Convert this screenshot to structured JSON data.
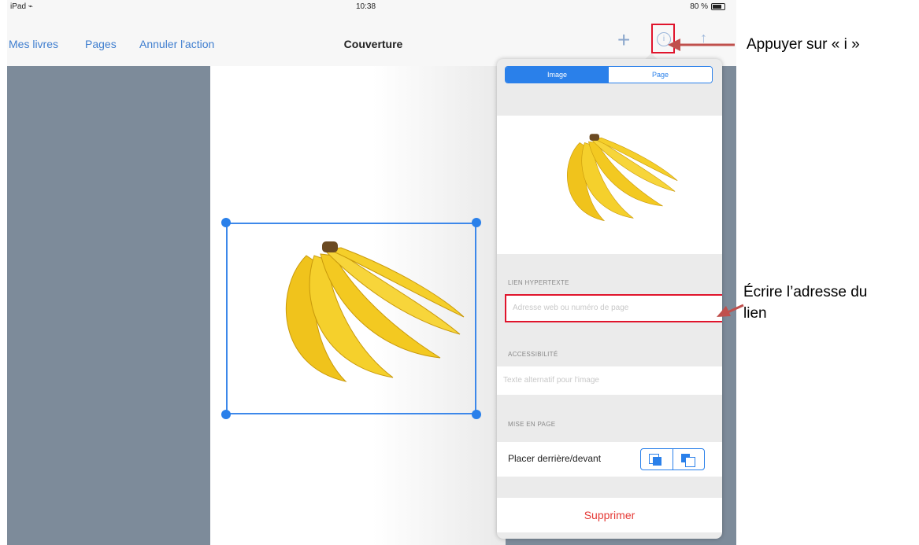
{
  "status_bar": {
    "device": "iPad",
    "time": "10:38",
    "battery": "80 %",
    "battery_level": 0.8
  },
  "nav": {
    "my_books": "Mes livres",
    "pages": "Pages",
    "undo": "Annuler l'action",
    "title": "Couverture",
    "info_glyph": "i"
  },
  "popover": {
    "tabs": [
      {
        "label": "Image",
        "active": true
      },
      {
        "label": "Page",
        "active": false
      }
    ],
    "hyperlink_label": "LIEN HYPERTEXTE",
    "hyperlink_placeholder": "Adresse web ou numéro de page",
    "accessibility_label": "ACCESSIBILITÉ",
    "alt_text_placeholder": "Texte alternatif pour l'image",
    "layout_label": "MISE EN PAGE",
    "order_label": "Placer derrière/devant",
    "delete": "Supprimer"
  },
  "annotations": {
    "info": "Appuyer sur « i »",
    "link_line1": "Écrire l’adresse du",
    "link_line2": "lien"
  },
  "colors": {
    "accent": "#2a80ea",
    "highlight": "#e0142c",
    "destructive": "#e53935",
    "annotation_arrow": "#c0504d"
  },
  "icons": [
    "wifi-icon",
    "battery-icon",
    "add-icon",
    "info-icon",
    "share-icon",
    "send-backward-icon",
    "bring-forward-icon",
    "banana-image"
  ]
}
